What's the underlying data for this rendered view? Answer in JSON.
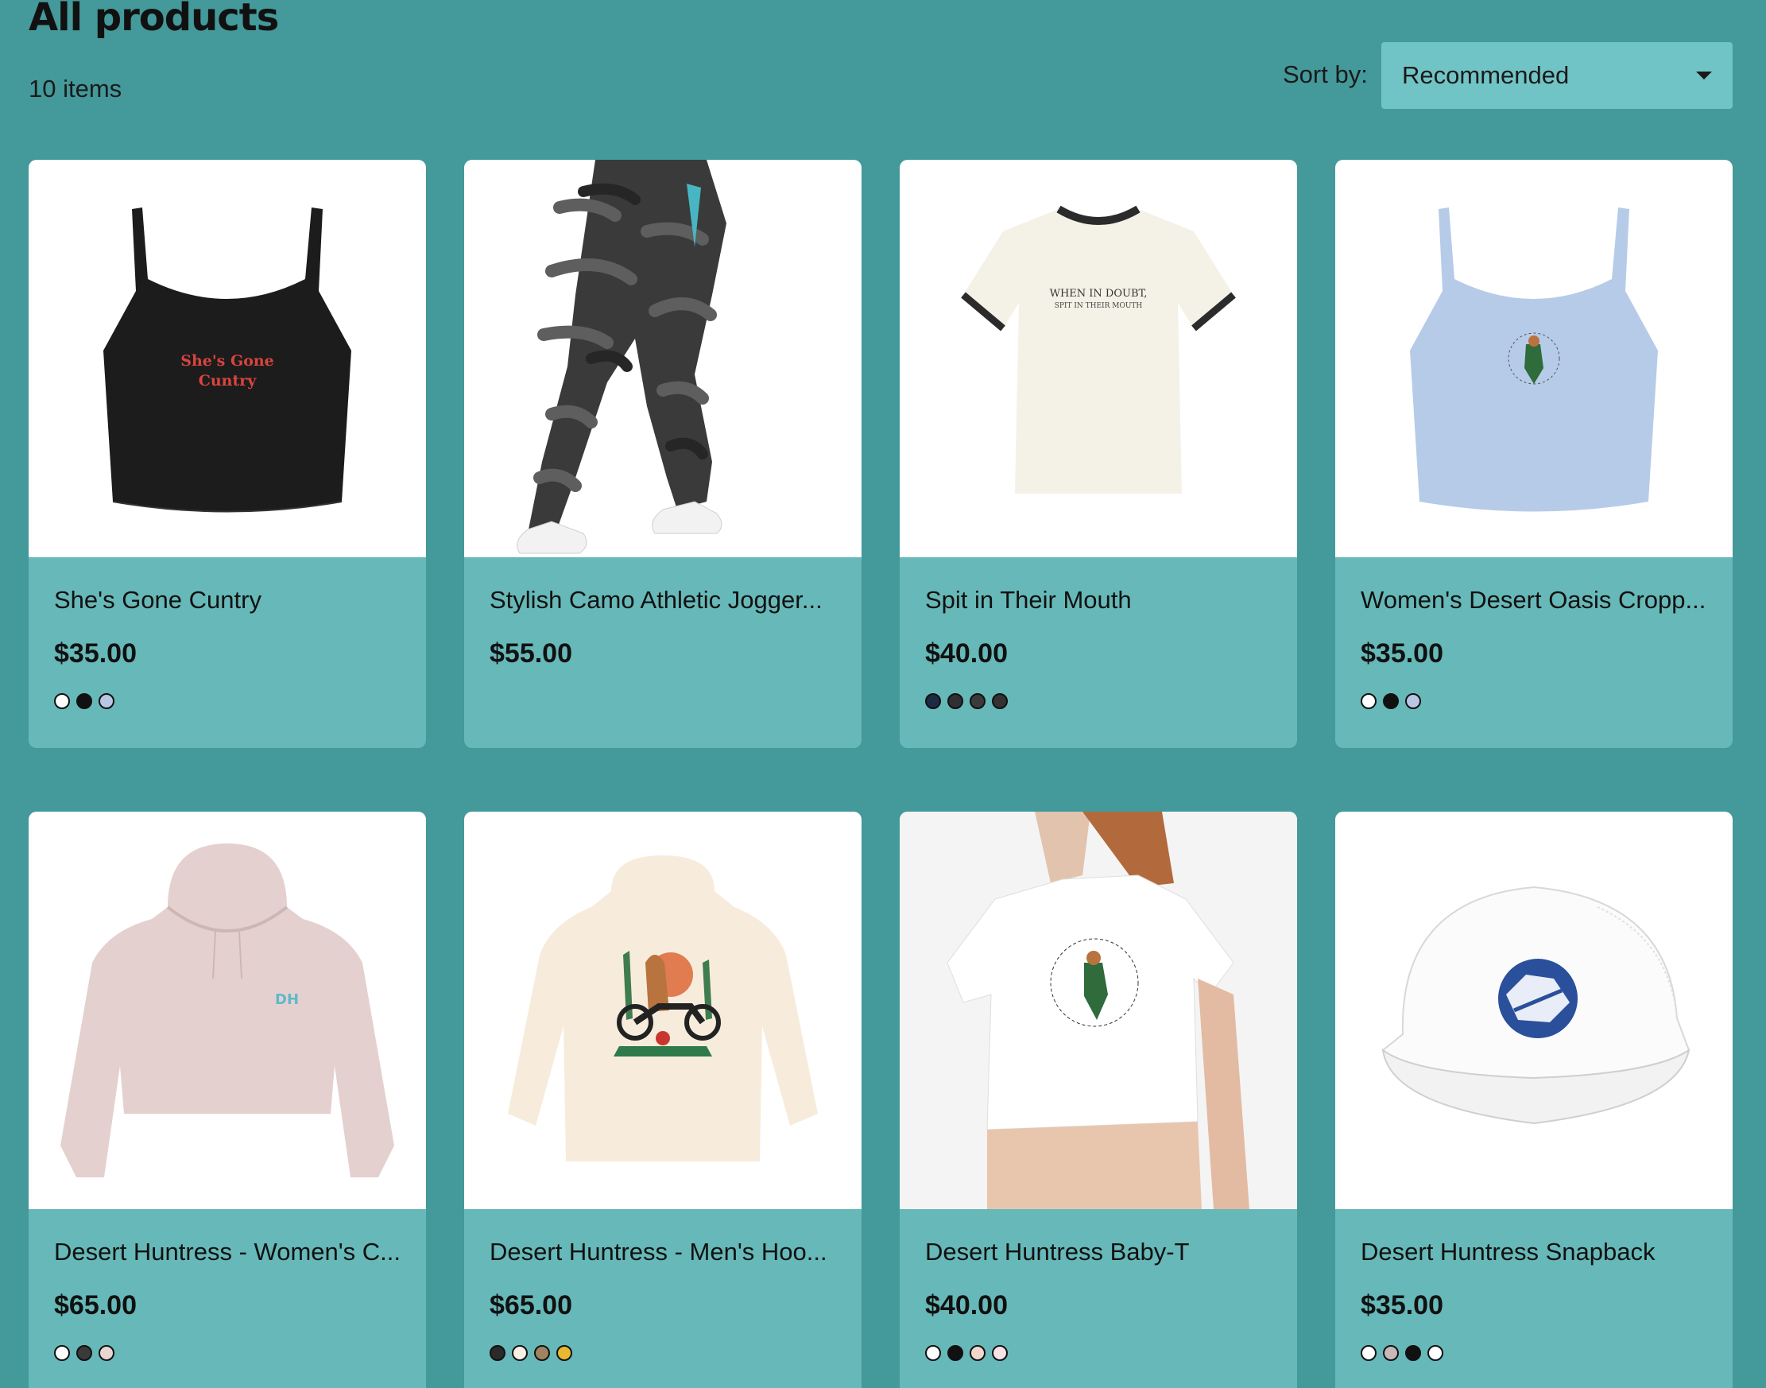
{
  "header": {
    "title": "All products",
    "item_count": "10 items",
    "sort_label": "Sort by:",
    "sort_value": "Recommended"
  },
  "products": [
    {
      "title": "She's Gone Cuntry",
      "price": "$35.00",
      "image": "black-crop-tank-top",
      "print": [
        "She's Gone",
        "Cuntry"
      ],
      "swatches": [
        "#ffffff",
        "#111111",
        "#b9c6e4"
      ]
    },
    {
      "title": "Stylish Camo Athletic Jogger...",
      "price": "$55.00",
      "image": "camo-joggers",
      "swatches": []
    },
    {
      "title": "Spit in Their Mouth",
      "price": "$40.00",
      "image": "ringer-tee",
      "print": [
        "WHEN IN DOUBT,",
        "SPIT IN THEIR MOUTH"
      ],
      "swatches": [
        "#1d2a44",
        "#2f2f34",
        "#3b3b3b",
        "#333333"
      ]
    },
    {
      "title": "Women's Desert Oasis Cropp...",
      "price": "$35.00",
      "image": "blue-crop-tank-top",
      "swatches": [
        "#ffffff",
        "#111111",
        "#b9c6e4"
      ]
    },
    {
      "title": "Desert Huntress - Women's C...",
      "price": "$65.00",
      "image": "pink-crop-hoodie",
      "print": [
        "DH"
      ],
      "swatches": [
        "#ffffff",
        "#3a3a3a",
        "#e9d6d3"
      ]
    },
    {
      "title": "Desert Huntress - Men's Hoo...",
      "price": "$65.00",
      "image": "cream-hoodie-back",
      "swatches": [
        "#2a2a2a",
        "#f6f1e4",
        "#a08461",
        "#e8b830"
      ]
    },
    {
      "title": "Desert Huntress Baby-T",
      "price": "$40.00",
      "image": "white-baby-tee",
      "swatches": [
        "#ffffff",
        "#111111",
        "#f3d7cd",
        "#f6e3e6"
      ]
    },
    {
      "title": "Desert Huntress Snapback",
      "price": "$35.00",
      "image": "white-trucker-cap",
      "swatches": [
        "#ffffff",
        "#c8b8b8",
        "#111111",
        "#ffffff"
      ]
    }
  ],
  "colors": {
    "background": "#44999a",
    "card_info": "#67b8b8",
    "select": "#71c4c6"
  }
}
